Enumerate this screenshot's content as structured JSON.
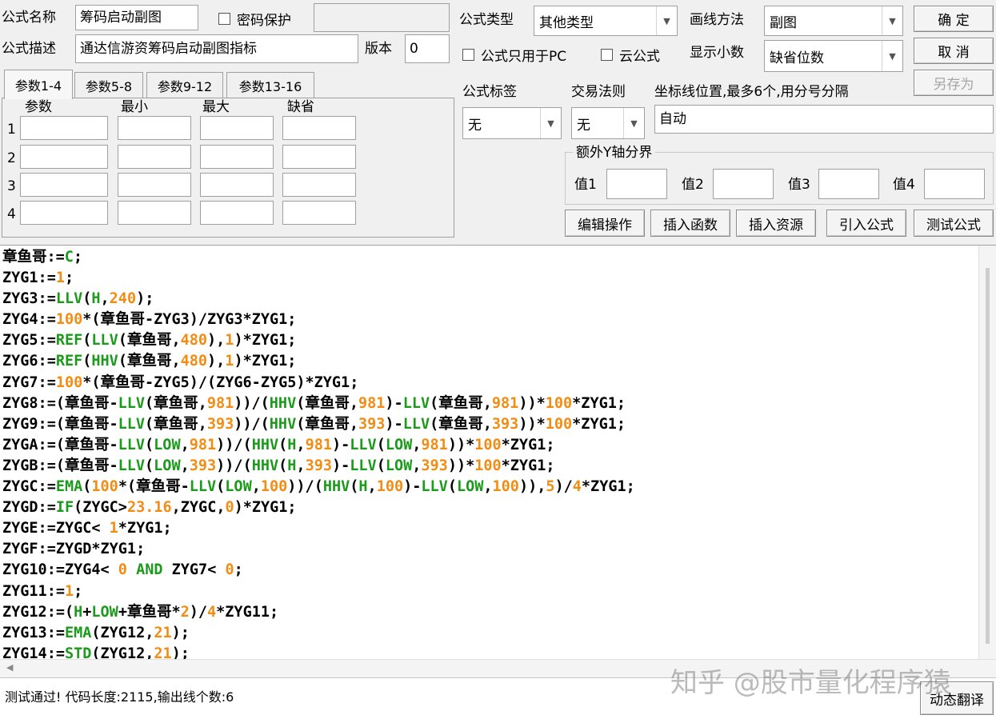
{
  "form": {
    "name_label": "公式名称",
    "name_value": "筹码启动副图",
    "password_label": "密码保护",
    "desc_label": "公式描述",
    "desc_value": "通达信游资筹码启动副图指标",
    "version_label": "版本",
    "version_value": "0",
    "type_label": "公式类型",
    "type_value": "其他类型",
    "draw_label": "画线方法",
    "draw_value": "副图",
    "pc_only_label": "公式只用于PC",
    "cloud_label": "云公式",
    "decimals_label": "显示小数",
    "decimals_value": "缺省位数",
    "tag_label": "公式标签",
    "tag_value": "无",
    "trade_label": "交易法则",
    "trade_value": "无",
    "coord_label": "坐标线位置,最多6个,用分号分隔",
    "coord_value": "自动",
    "yaxis_group": "额外Y轴分界",
    "v1": "值1",
    "v2": "值2",
    "v3": "值3",
    "v4": "值4"
  },
  "buttons": {
    "ok": "确 定",
    "cancel": "取 消",
    "saveas": "另存为",
    "edit": "编辑操作",
    "insert_func": "插入函数",
    "insert_res": "插入资源",
    "import": "引入公式",
    "test": "测试公式",
    "translate": "动态翻译"
  },
  "tabs": [
    "参数1-4",
    "参数5-8",
    "参数9-12",
    "参数13-16"
  ],
  "params": {
    "headers": [
      "参数",
      "最小",
      "最大",
      "缺省"
    ],
    "rows": [
      "1",
      "2",
      "3",
      "4"
    ]
  },
  "code_lines": [
    [
      [
        "t",
        "章鱼哥:="
      ],
      [
        "k",
        "C"
      ],
      [
        "t",
        ";"
      ]
    ],
    [
      [
        "t",
        "ZYG1:="
      ],
      [
        "n",
        "1"
      ],
      [
        "t",
        ";"
      ]
    ],
    [
      [
        "t",
        "ZYG3:="
      ],
      [
        "k",
        "LLV"
      ],
      [
        "t",
        "("
      ],
      [
        "k",
        "H"
      ],
      [
        "t",
        ","
      ],
      [
        "n",
        "240"
      ],
      [
        "t",
        ");"
      ]
    ],
    [
      [
        "t",
        "ZYG4:="
      ],
      [
        "n",
        "100"
      ],
      [
        "t",
        "*(章鱼哥-ZYG3)/ZYG3*ZYG1;"
      ]
    ],
    [
      [
        "t",
        "ZYG5:="
      ],
      [
        "k",
        "REF"
      ],
      [
        "t",
        "("
      ],
      [
        "k",
        "LLV"
      ],
      [
        "t",
        "(章鱼哥,"
      ],
      [
        "n",
        "480"
      ],
      [
        "t",
        "),"
      ],
      [
        "n",
        "1"
      ],
      [
        "t",
        ")*ZYG1;"
      ]
    ],
    [
      [
        "t",
        "ZYG6:="
      ],
      [
        "k",
        "REF"
      ],
      [
        "t",
        "("
      ],
      [
        "k",
        "HHV"
      ],
      [
        "t",
        "(章鱼哥,"
      ],
      [
        "n",
        "480"
      ],
      [
        "t",
        "),"
      ],
      [
        "n",
        "1"
      ],
      [
        "t",
        ")*ZYG1;"
      ]
    ],
    [
      [
        "t",
        "ZYG7:="
      ],
      [
        "n",
        "100"
      ],
      [
        "t",
        "*(章鱼哥-ZYG5)/(ZYG6-ZYG5)*ZYG1;"
      ]
    ],
    [
      [
        "t",
        "ZYG8:=(章鱼哥-"
      ],
      [
        "k",
        "LLV"
      ],
      [
        "t",
        "(章鱼哥,"
      ],
      [
        "n",
        "981"
      ],
      [
        "t",
        "))/("
      ],
      [
        "k",
        "HHV"
      ],
      [
        "t",
        "(章鱼哥,"
      ],
      [
        "n",
        "981"
      ],
      [
        "t",
        ")-"
      ],
      [
        "k",
        "LLV"
      ],
      [
        "t",
        "(章鱼哥,"
      ],
      [
        "n",
        "981"
      ],
      [
        "t",
        "))*"
      ],
      [
        "n",
        "100"
      ],
      [
        "t",
        "*ZYG1;"
      ]
    ],
    [
      [
        "t",
        "ZYG9:=(章鱼哥-"
      ],
      [
        "k",
        "LLV"
      ],
      [
        "t",
        "(章鱼哥,"
      ],
      [
        "n",
        "393"
      ],
      [
        "t",
        "))/("
      ],
      [
        "k",
        "HHV"
      ],
      [
        "t",
        "(章鱼哥,"
      ],
      [
        "n",
        "393"
      ],
      [
        "t",
        ")-"
      ],
      [
        "k",
        "LLV"
      ],
      [
        "t",
        "(章鱼哥,"
      ],
      [
        "n",
        "393"
      ],
      [
        "t",
        "))*"
      ],
      [
        "n",
        "100"
      ],
      [
        "t",
        "*ZYG1;"
      ]
    ],
    [
      [
        "t",
        "ZYGA:=(章鱼哥-"
      ],
      [
        "k",
        "LLV"
      ],
      [
        "t",
        "("
      ],
      [
        "k",
        "LOW"
      ],
      [
        "t",
        ","
      ],
      [
        "n",
        "981"
      ],
      [
        "t",
        "))/("
      ],
      [
        "k",
        "HHV"
      ],
      [
        "t",
        "("
      ],
      [
        "k",
        "H"
      ],
      [
        "t",
        ","
      ],
      [
        "n",
        "981"
      ],
      [
        "t",
        ")-"
      ],
      [
        "k",
        "LLV"
      ],
      [
        "t",
        "("
      ],
      [
        "k",
        "LOW"
      ],
      [
        "t",
        ","
      ],
      [
        "n",
        "981"
      ],
      [
        "t",
        "))*"
      ],
      [
        "n",
        "100"
      ],
      [
        "t",
        "*ZYG1;"
      ]
    ],
    [
      [
        "t",
        "ZYGB:=(章鱼哥-"
      ],
      [
        "k",
        "LLV"
      ],
      [
        "t",
        "("
      ],
      [
        "k",
        "LOW"
      ],
      [
        "t",
        ","
      ],
      [
        "n",
        "393"
      ],
      [
        "t",
        "))/("
      ],
      [
        "k",
        "HHV"
      ],
      [
        "t",
        "("
      ],
      [
        "k",
        "H"
      ],
      [
        "t",
        ","
      ],
      [
        "n",
        "393"
      ],
      [
        "t",
        ")-"
      ],
      [
        "k",
        "LLV"
      ],
      [
        "t",
        "("
      ],
      [
        "k",
        "LOW"
      ],
      [
        "t",
        ","
      ],
      [
        "n",
        "393"
      ],
      [
        "t",
        "))*"
      ],
      [
        "n",
        "100"
      ],
      [
        "t",
        "*ZYG1;"
      ]
    ],
    [
      [
        "t",
        "ZYGC:="
      ],
      [
        "k",
        "EMA"
      ],
      [
        "t",
        "("
      ],
      [
        "n",
        "100"
      ],
      [
        "t",
        "*(章鱼哥-"
      ],
      [
        "k",
        "LLV"
      ],
      [
        "t",
        "("
      ],
      [
        "k",
        "LOW"
      ],
      [
        "t",
        ","
      ],
      [
        "n",
        "100"
      ],
      [
        "t",
        "))/("
      ],
      [
        "k",
        "HHV"
      ],
      [
        "t",
        "("
      ],
      [
        "k",
        "H"
      ],
      [
        "t",
        ","
      ],
      [
        "n",
        "100"
      ],
      [
        "t",
        ")-"
      ],
      [
        "k",
        "LLV"
      ],
      [
        "t",
        "("
      ],
      [
        "k",
        "LOW"
      ],
      [
        "t",
        ","
      ],
      [
        "n",
        "100"
      ],
      [
        "t",
        ")),"
      ],
      [
        "n",
        "5"
      ],
      [
        "t",
        ")/"
      ],
      [
        "n",
        "4"
      ],
      [
        "t",
        "*ZYG1;"
      ]
    ],
    [
      [
        "t",
        "ZYGD:="
      ],
      [
        "k",
        "IF"
      ],
      [
        "t",
        "(ZYGC>"
      ],
      [
        "n",
        "23.16"
      ],
      [
        "t",
        ",ZYGC,"
      ],
      [
        "n",
        "0"
      ],
      [
        "t",
        ")*ZYG1;"
      ]
    ],
    [
      [
        "t",
        "ZYGE:=ZYGC< "
      ],
      [
        "n",
        "1"
      ],
      [
        "t",
        "*ZYG1;"
      ]
    ],
    [
      [
        "t",
        "ZYGF:=ZYGD*ZYG1;"
      ]
    ],
    [
      [
        "t",
        "ZYG10:=ZYG4< "
      ],
      [
        "n",
        "0"
      ],
      [
        "t",
        " "
      ],
      [
        "k",
        "AND"
      ],
      [
        "t",
        " ZYG7< "
      ],
      [
        "n",
        "0"
      ],
      [
        "t",
        ";"
      ]
    ],
    [
      [
        "t",
        "ZYG11:="
      ],
      [
        "n",
        "1"
      ],
      [
        "t",
        ";"
      ]
    ],
    [
      [
        "t",
        "ZYG12:=("
      ],
      [
        "k",
        "H"
      ],
      [
        "t",
        "+"
      ],
      [
        "k",
        "LOW"
      ],
      [
        "t",
        "+章鱼哥*"
      ],
      [
        "n",
        "2"
      ],
      [
        "t",
        ")/"
      ],
      [
        "n",
        "4"
      ],
      [
        "t",
        "*ZYG11;"
      ]
    ],
    [
      [
        "t",
        "ZYG13:="
      ],
      [
        "k",
        "EMA"
      ],
      [
        "t",
        "(ZYG12,"
      ],
      [
        "n",
        "21"
      ],
      [
        "t",
        ");"
      ]
    ],
    [
      [
        "t",
        "ZYG14:="
      ],
      [
        "k",
        "STD"
      ],
      [
        "t",
        "(ZYG12,"
      ],
      [
        "n",
        "21"
      ],
      [
        "t",
        ");"
      ]
    ]
  ],
  "status": "测试通过! 代码长度:2115,输出线个数:6",
  "watermark": "知乎 @股市量化程序猿"
}
